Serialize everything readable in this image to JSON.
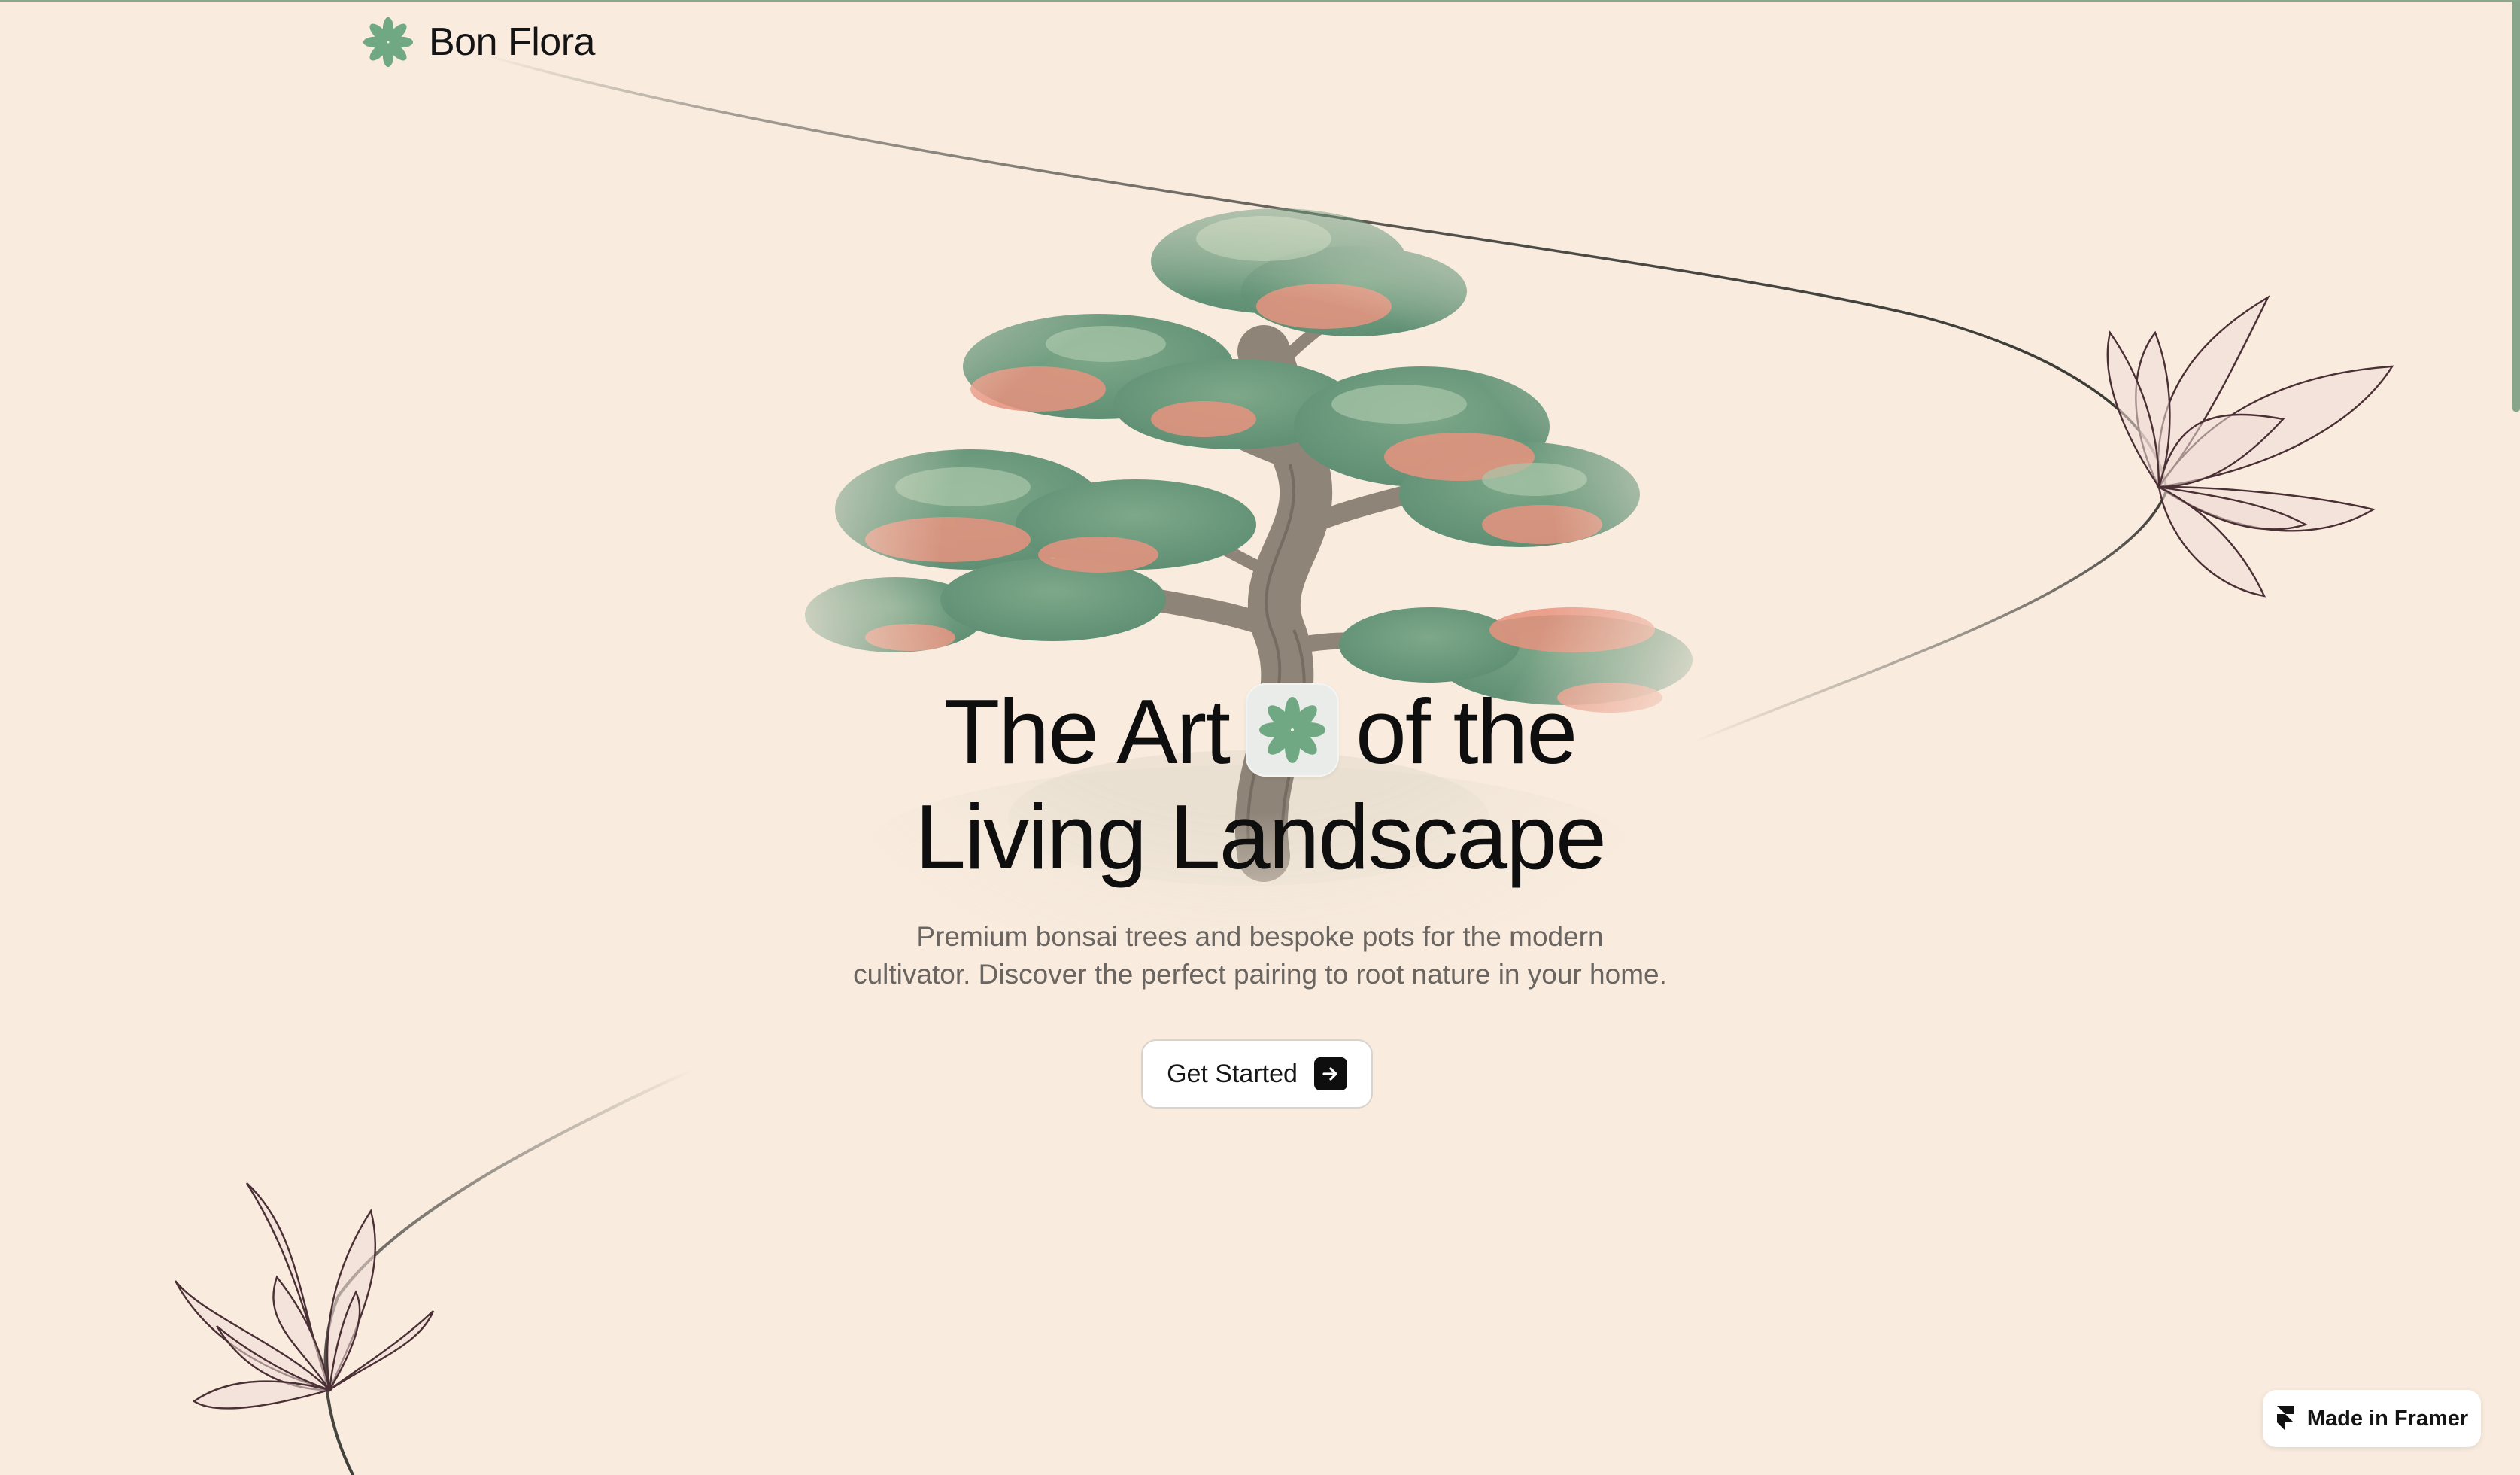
{
  "brand": {
    "name": "Bon Flora",
    "logo_icon": "pinwheel-flower-icon",
    "accent_color": "#6fa882"
  },
  "hero": {
    "title_line1_a": "The Art",
    "title_line1_b": "of the",
    "title_line2": "Living Landscape",
    "subtitle_line1": "Premium bonsai trees and bespoke pots for the modern",
    "subtitle_line2": "cultivator. Discover the perfect pairing to root nature in your home.",
    "cta_label": "Get Started",
    "cta_icon": "arrow-right-icon",
    "illustration": "bonsai-tree-illustration"
  },
  "badge": {
    "label": "Made in Framer",
    "icon": "framer-logo-icon"
  },
  "colors": {
    "background": "#f9ecdf",
    "text": "#0e0e0e",
    "muted_text": "#6a6560",
    "foliage_green": "#6f9a7e",
    "foliage_coral": "#e7937f"
  }
}
